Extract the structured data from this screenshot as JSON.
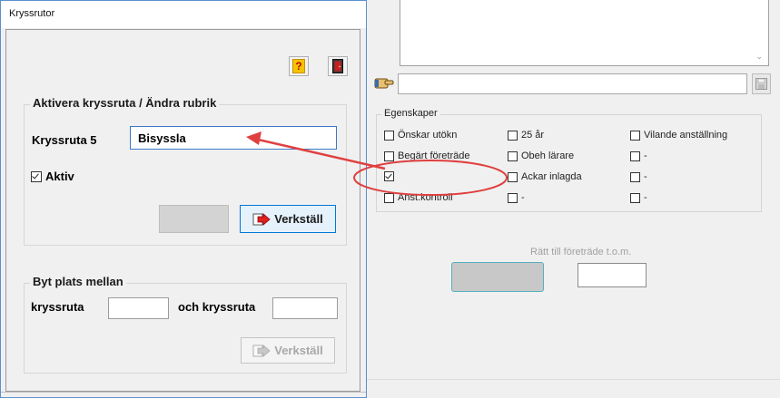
{
  "dialog": {
    "title": "Kryssrutor",
    "help_icon": "question-mark-icon",
    "exit_icon": "exit-door-icon",
    "activate_group": {
      "title": "Aktivera kryssruta / Ändra rubrik",
      "field_label": "Kryssruta 5",
      "field_value": "Bisyssla",
      "aktiv_label": "Aktiv",
      "aktiv_checked": true,
      "apply_label": "Verkställ"
    },
    "swap_group": {
      "title": "Byt plats mellan",
      "label_1": "kryssruta",
      "label_2": "och kryssruta",
      "value_1": "",
      "value_2": "",
      "apply_label": "Verkställ"
    }
  },
  "background": {
    "properties_legend": "Egenskaper",
    "checkboxes": [
      {
        "label": "Önskar utökn",
        "checked": false
      },
      {
        "label": "25 år",
        "checked": false
      },
      {
        "label": "Vilande anställning",
        "checked": false
      },
      {
        "label": "Begärt företräde",
        "checked": false
      },
      {
        "label": "Obeh lärare",
        "checked": false
      },
      {
        "label": "-",
        "checked": false
      },
      {
        "label": "",
        "checked": true
      },
      {
        "label": "Ackar inlagda",
        "checked": false
      },
      {
        "label": "-",
        "checked": false
      },
      {
        "label": "Anst.kontroll",
        "checked": false
      },
      {
        "label": "-",
        "checked": false
      },
      {
        "label": "-",
        "checked": false
      }
    ],
    "date_label": "Rätt till företräde t.o.m.",
    "date_value": ""
  },
  "colors": {
    "annotation_red": "#e04040",
    "dialog_border": "#5a8fd0",
    "focus_blue": "#0078d7"
  }
}
